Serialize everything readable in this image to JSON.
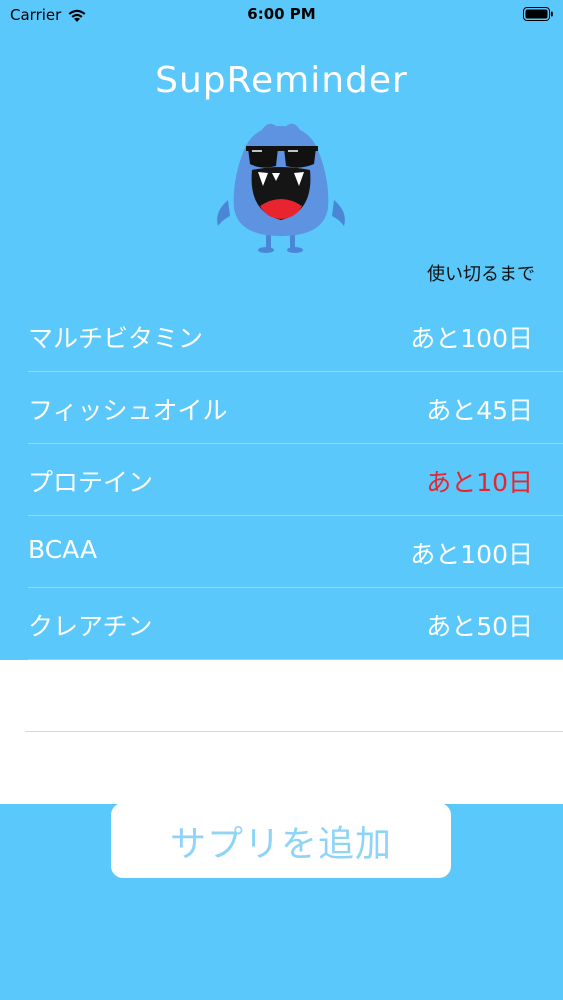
{
  "status_bar": {
    "carrier": "Carrier",
    "time": "6:00 PM"
  },
  "app": {
    "title": "SupReminder"
  },
  "list": {
    "column_header": "使い切るまで",
    "items": [
      {
        "name": "マルチビタミン",
        "remaining": "あと100日",
        "status": "normal"
      },
      {
        "name": "フィッシュオイル",
        "remaining": "あと45日",
        "status": "normal"
      },
      {
        "name": "プロテイン",
        "remaining": "あと10日",
        "status": "warning"
      },
      {
        "name": "BCAA",
        "remaining": "あと100日",
        "status": "normal"
      },
      {
        "name": "クレアチン",
        "remaining": "あと50日",
        "status": "normal"
      }
    ]
  },
  "actions": {
    "add_label": "サプリを追加"
  },
  "colors": {
    "background": "#5ac8fa",
    "warning": "#e8242f",
    "button_text": "#8fd4f7"
  }
}
